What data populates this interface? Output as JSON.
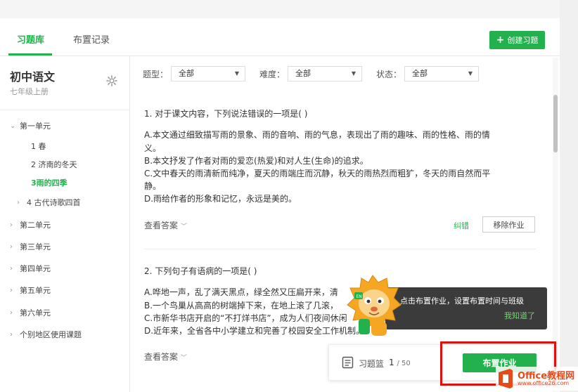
{
  "tabs": [
    {
      "label": "习题库"
    },
    {
      "label": "布置记录"
    }
  ],
  "create_button": "创建习题",
  "sidebar": {
    "title": "初中语文",
    "subtitle": "七年级上册",
    "tree": [
      {
        "label": "第一单元"
      },
      {
        "label": "1 春"
      },
      {
        "label": "2 济南的冬天"
      },
      {
        "label": "3雨的四季"
      },
      {
        "label": "4 古代诗歌四首"
      },
      {
        "label": "第二单元"
      },
      {
        "label": "第三单元"
      },
      {
        "label": "第四单元"
      },
      {
        "label": "第五单元"
      },
      {
        "label": "第六单元"
      },
      {
        "label": "个别地区使用课题"
      }
    ]
  },
  "filters": [
    {
      "label": "题型：",
      "value": "全部"
    },
    {
      "label": "难度：",
      "value": "全部"
    },
    {
      "label": "状态：",
      "value": "全部"
    }
  ],
  "questions": [
    {
      "title": "1. 对于课文内容，下列说法错误的一项是(    )",
      "lines": [
        "A.本文通过细致描写雨的景象、雨的音响、雨的气息，表现出了雨的趣味、雨的性格、雨的情",
        "义。",
        "B.本文抒发了作者对雨的爱恋(热爱)和对人生(生命)的追求。",
        "C.文中春天的雨清新而纯净，夏天的雨端庄而沉静，秋天的雨热烈而粗犷，冬天的雨自然而平",
        "静。",
        "D.雨给作者的形象和记忆，永远是美的。"
      ]
    },
    {
      "title": "2. 下列句子有语病的一项是(    )",
      "lines": [
        "A.哗地一声，乱了满天黑点，绿全然又压扁开来，清",
        "B.一个鸟巢从高高的树端掉下来，在地上滚了几滚，",
        "C.市新华书店开启的“不打烊书店”，成为人们夜间休闲",
        "D.近年来，全省各中小学建立和完善了校园安全工作机制。"
      ]
    }
  ],
  "view_answer": "查看答案",
  "correct_link": "纠错",
  "remove_button": "移除作业",
  "tooltip": {
    "text": "点击布置作业，设置布置时间与班级",
    "ok": "我知道了"
  },
  "basket": {
    "label": "习题篮",
    "count": "1",
    "total": "/ 50"
  },
  "assign_button": "布置作业",
  "watermark": {
    "text": "Office教程网",
    "sub": "www.office26.com"
  },
  "colors": {
    "accent": "#22b14c",
    "highlight_box": "#e01010",
    "tooltip_bg": "#3b3b3b"
  }
}
